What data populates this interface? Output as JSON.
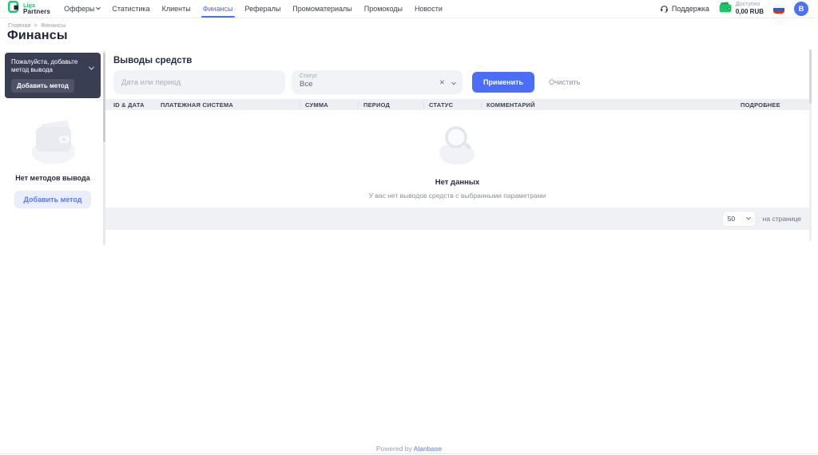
{
  "colors": {
    "accent_blue": "#4a6dfa",
    "brand_green": "#19cc6b",
    "dark_text": "#262b40",
    "muted_text": "#9aa0ae",
    "sidebar_panel_bg": "#3a3e53",
    "table_header_bg": "#edeff3",
    "pagination_bg": "#f0f1f4"
  },
  "icons": {
    "logo": "liga-partners-logo",
    "support": "headset-icon",
    "balance": "green-wallet-icon",
    "language": "russian-flag-icon",
    "dropdown": "chevron-down-icon",
    "clear": "x-icon",
    "sidebar_illustration": "wallet-illustration",
    "empty_illustration": "magnifier-illustration"
  },
  "brand": {
    "name_top": "Liga",
    "name_bottom": "Partners"
  },
  "nav": {
    "items": [
      "Офферы",
      "Статистика",
      "Клиенты",
      "Финансы",
      "Рефералы",
      "Промоматериалы",
      "Промокоды",
      "Новости"
    ],
    "active": "Финансы"
  },
  "topbar": {
    "support_label": "Поддержка",
    "balance_label": "Доступно",
    "balance_value": "0,00 RUB",
    "avatar_initial": "B"
  },
  "breadcrumb": {
    "home": "Главная",
    "separator": ">",
    "current": "Финансы"
  },
  "page_title": "Финансы",
  "sidebar": {
    "notice_text": "Пожалуйста, добавьте метод вывода",
    "notice_button_label": "Добавить метод",
    "empty_title": "Нет методов вывода",
    "add_button_label": "Добавить метод"
  },
  "finances": {
    "section_title": "Выводы средств",
    "filters": {
      "date_placeholder": "Дата или период",
      "status_label": "Статус",
      "status_value": "Все",
      "clear_icon": "✕",
      "apply_label": "Применить",
      "clear_label": "Очистить"
    },
    "table_columns": [
      "ID & ДАТА",
      "ПЛАТЕЖНАЯ СИСТЕМА",
      "СУММА",
      "ПЕРИОД",
      "СТАТУС",
      "КОММЕНТАРИЙ",
      "ПОДРОБНЕЕ"
    ],
    "empty_state": {
      "title": "Нет данных",
      "subtitle": "У вас нет выводов средств с выбранными параметрами"
    },
    "pagination": {
      "per_page": "50",
      "per_page_label": "на странице"
    }
  },
  "footer": {
    "powered_by": "Powered by",
    "brand_link": "Alanbase"
  }
}
